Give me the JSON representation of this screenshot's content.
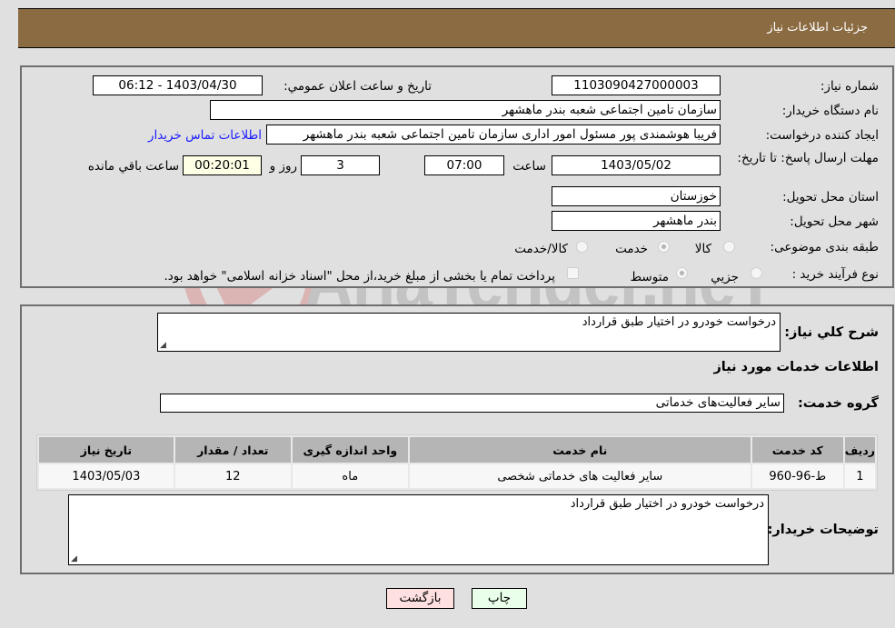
{
  "header": {
    "title": "جزئیات اطلاعات نیاز"
  },
  "form": {
    "need_number_label": "شماره نیاز:",
    "need_number": "1103090427000003",
    "announce_label": "تاریخ و ساعت اعلان عمومي:",
    "announce_value": "1403/04/30 - 06:12",
    "buyer_org_label": "نام دستگاه خریدار:",
    "buyer_org": "سازمان تامین اجتماعی شعبه بندر ماهشهر",
    "creator_label": "ایجاد کننده درخواست:",
    "creator": "فریبا هوشمندی پور مسئول امور اداری سازمان تامین اجتماعی شعبه بندر ماهشهر",
    "contact_link": "اطلاعات تماس خریدار",
    "deadline_label": "مهلت ارسال پاسخ: تا تاریخ:",
    "deadline_date": "1403/05/02",
    "time_label": "ساعت",
    "deadline_time": "07:00",
    "days_value": "3",
    "days_label": "روز و",
    "remaining_time": "00:20:01",
    "remaining_label": "ساعت باقي مانده",
    "province_label": "استان محل تحویل:",
    "province": "خوزستان",
    "city_label": "شهر محل تحویل:",
    "city": "بندر ماهشهر",
    "category_label": "طبقه بندی موضوعی:",
    "category_options": [
      {
        "label": "کالا",
        "checked": false
      },
      {
        "label": "خدمت",
        "checked": true
      },
      {
        "label": "کالا/خدمت",
        "checked": false
      }
    ],
    "purchase_type_label": "نوع فرآیند خرید :",
    "purchase_options": [
      {
        "label": "جزیي",
        "checked": false
      },
      {
        "label": "متوسط",
        "checked": true
      }
    ],
    "treasury_note": "پرداخت تمام یا بخشی از مبلغ خرید،از محل \"اسناد خزانه اسلامی\" خواهد بود."
  },
  "details": {
    "summary_label": "شرح كلي نياز:",
    "summary": "درخواست خودرو در اختیار طبق قرارداد",
    "services_heading": "اطلاعات خدمات مورد نیاز",
    "service_group_label": "گروه خدمت:",
    "service_group": "سایر فعالیت‌های خدماتی",
    "table": {
      "headers": [
        "ردیف",
        "کد خدمت",
        "نام خدمت",
        "واحد اندازه گیری",
        "تعداد / مقدار",
        "تاریخ نیاز"
      ],
      "rows": [
        [
          "1",
          "ط-96-960",
          "سایر فعالیت های خدماتی شخصی",
          "ماه",
          "12",
          "1403/05/03"
        ]
      ]
    },
    "buyer_notes_label": "توضیحات خریدار:",
    "buyer_notes": "درخواست خودرو در اختیار طبق قرارداد"
  },
  "buttons": {
    "back": "بازگشت",
    "print": "چاپ"
  },
  "watermark": {
    "text": "AriaTender.neT"
  },
  "colors": {
    "header_bg": "#8b6b42",
    "link": "#1a1aff",
    "back_btn": "#ffe0e0",
    "print_btn": "#e9ffe9",
    "remaining_bg": "#ffffe6"
  }
}
